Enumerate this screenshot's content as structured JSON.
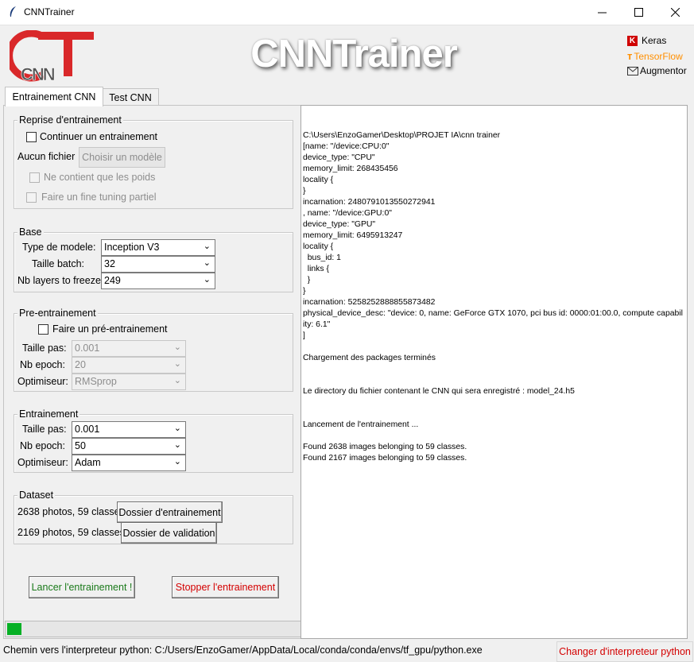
{
  "window": {
    "title": "CNNTrainer",
    "minimize": "—",
    "maximize": "☐",
    "close": "✕"
  },
  "header": {
    "logo_text": "CNN",
    "title": "CNNTrainer",
    "brands": [
      "Keras",
      "TensorFlow",
      "Augmentor"
    ],
    "colors": {
      "logo_red": "#d9282a",
      "keras_red": "#d00000",
      "tf_orange": "#ff8f00"
    }
  },
  "tabs": [
    {
      "label": "Entrainement CNN",
      "active": true
    },
    {
      "label": "Test CNN",
      "active": false
    }
  ],
  "reprise": {
    "legend": "Reprise d'entrainement",
    "continue_label": "Continuer un entrainement",
    "file_label": "Aucun fichier",
    "choose_button": "Choisir un modèle",
    "weights_only_label": "Ne contient que les poids",
    "fine_tuning_label": "Faire un fine tuning partiel"
  },
  "base": {
    "legend": "Base",
    "model_type_label": "Type de modele:",
    "model_type_value": "Inception V3",
    "batch_label": "Taille batch:",
    "batch_value": "32",
    "freeze_label": "Nb layers to freeze:",
    "freeze_value": "249"
  },
  "pre": {
    "legend": "Pre-entrainement",
    "checkbox_label": "Faire un pré-entrainement",
    "step_label": "Taille pas:",
    "step_value": "0.001",
    "epoch_label": "Nb epoch:",
    "epoch_value": "20",
    "optim_label": "Optimiseur:",
    "optim_value": "RMSprop"
  },
  "train": {
    "legend": "Entrainement",
    "step_label": "Taille pas:",
    "step_value": "0.001",
    "epoch_label": "Nb epoch:",
    "epoch_value": "50",
    "optim_label": "Optimiseur:",
    "optim_value": "Adam"
  },
  "dataset": {
    "legend": "Dataset",
    "train_count": "2638 photos, 59 classes",
    "train_button": "Dossier d'entrainement",
    "val_count": "2169 photos, 59 classes",
    "val_button": "Dossier de validation"
  },
  "actions": {
    "start": "Lancer l'entrainement !",
    "stop": "Stopper l'entrainement",
    "start_color": "#1a7a1a",
    "stop_color": "#d40000"
  },
  "progress": {
    "value": 0.05,
    "color": "#06b025"
  },
  "console": {
    "lines": [
      "C:\\Users\\EnzoGamer\\Desktop\\PROJET IA\\cnn trainer",
      "[name: \"/device:CPU:0\"",
      "device_type: \"CPU\"",
      "memory_limit: 268435456",
      "locality {",
      "}",
      "incarnation: 2480791013550272941",
      ", name: \"/device:GPU:0\"",
      "device_type: \"GPU\"",
      "memory_limit: 6495913247",
      "locality {",
      "  bus_id: 1",
      "  links {",
      "  }",
      "}",
      "incarnation: 5258252888855873482",
      "physical_device_desc: \"device: 0, name: GeForce GTX 1070, pci bus id: 0000:01:00.0, compute capability: 6.1\"",
      "]",
      "",
      "Chargement des packages terminés",
      "",
      "",
      "Le directory du fichier contenant le CNN qui sera enregistré : model_24.h5",
      "",
      "",
      "Lancement de l'entrainement ...",
      "",
      "Found 2638 images belonging to 59 classes.",
      "Found 2167 images belonging to 59 classes."
    ]
  },
  "status": {
    "interpreter_label": "Chemin vers l'interpreteur python: C:/Users/EnzoGamer/AppData/Local/conda/conda/envs/tf_gpu/python.exe",
    "change_button": "Changer d'interpreteur python"
  }
}
